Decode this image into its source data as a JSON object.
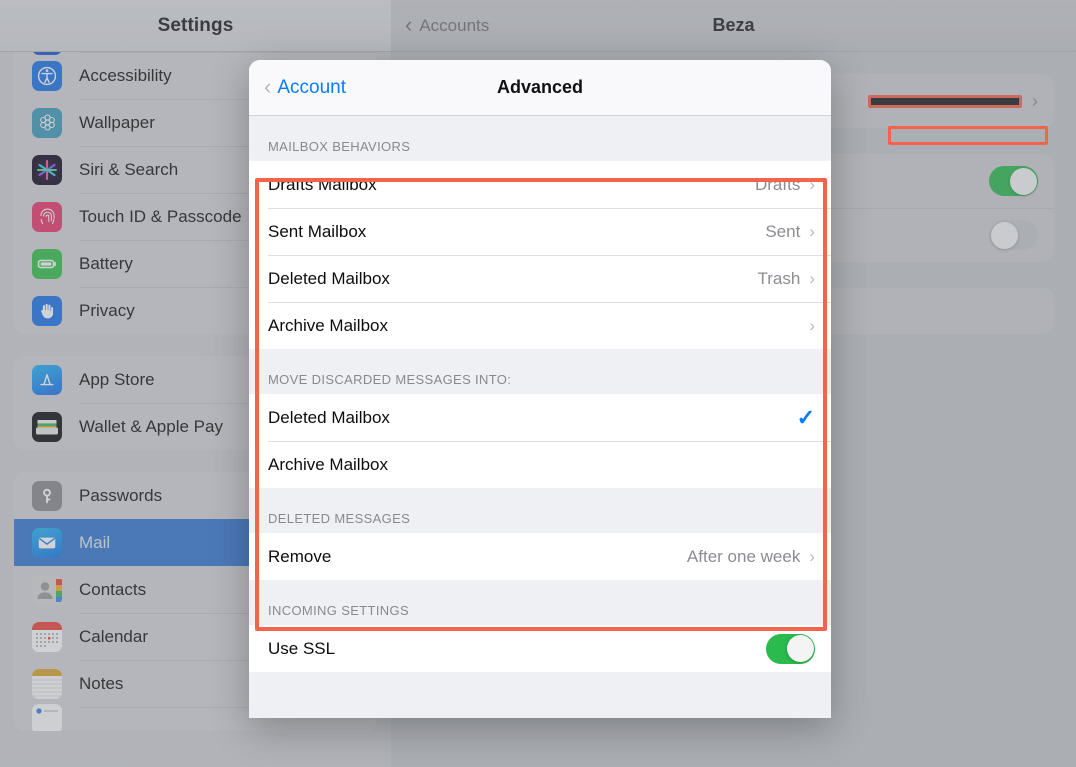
{
  "sidebar": {
    "title": "Settings",
    "groups": [
      {
        "items": [
          {
            "label": "",
            "icon": "partial-icon",
            "partial": true
          },
          {
            "label": "Accessibility",
            "icon": "accessibility-icon"
          },
          {
            "label": "Wallpaper",
            "icon": "wallpaper-icon"
          },
          {
            "label": "Siri & Search",
            "icon": "siri-icon"
          },
          {
            "label": "Touch ID & Passcode",
            "icon": "touchid-icon"
          },
          {
            "label": "Battery",
            "icon": "battery-icon"
          },
          {
            "label": "Privacy",
            "icon": "privacy-icon"
          }
        ]
      },
      {
        "items": [
          {
            "label": "App Store",
            "icon": "appstore-icon"
          },
          {
            "label": "Wallet & Apple Pay",
            "icon": "wallet-icon"
          }
        ]
      },
      {
        "items": [
          {
            "label": "Passwords",
            "icon": "passwords-icon"
          },
          {
            "label": "Mail",
            "icon": "mail-icon",
            "selected": true
          },
          {
            "label": "Contacts",
            "icon": "contacts-icon"
          },
          {
            "label": "Calendar",
            "icon": "calendar-icon"
          },
          {
            "label": "Notes",
            "icon": "notes-icon"
          }
        ]
      }
    ]
  },
  "detail": {
    "back_label": "Accounts",
    "title": "Beza",
    "account_value_redacted": "[redacted email address]",
    "toggle_mail_on": "on",
    "toggle_notes_off": "off"
  },
  "sheet": {
    "back_label": "Account",
    "title": "Advanced",
    "sections": [
      {
        "header": "MAILBOX BEHAVIORS",
        "rows": [
          {
            "label": "Drafts Mailbox",
            "value": "Drafts",
            "accessory": "chevron"
          },
          {
            "label": "Sent Mailbox",
            "value": "Sent",
            "accessory": "chevron"
          },
          {
            "label": "Deleted Mailbox",
            "value": "Trash",
            "accessory": "chevron"
          },
          {
            "label": "Archive Mailbox",
            "value": "",
            "accessory": "chevron"
          }
        ]
      },
      {
        "header": "MOVE DISCARDED MESSAGES INTO:",
        "rows": [
          {
            "label": "Deleted Mailbox",
            "value": "",
            "accessory": "checkmark"
          },
          {
            "label": "Archive Mailbox",
            "value": "",
            "accessory": "none"
          }
        ]
      },
      {
        "header": "DELETED MESSAGES",
        "rows": [
          {
            "label": "Remove",
            "value": "After one week",
            "accessory": "chevron"
          }
        ]
      },
      {
        "header": "INCOMING SETTINGS",
        "rows": [
          {
            "label": "Use SSL",
            "value": "",
            "accessory": "toggle-on"
          }
        ]
      }
    ]
  },
  "glyphs": {
    "chevron_right": "›",
    "chevron_left": "‹",
    "checkmark": "✓"
  },
  "colors": {
    "accent_blue": "#0a7cff",
    "annotation_red": "#f5634a",
    "toggle_green": "#2aba4e",
    "selected_row_blue": "#3478d4"
  }
}
